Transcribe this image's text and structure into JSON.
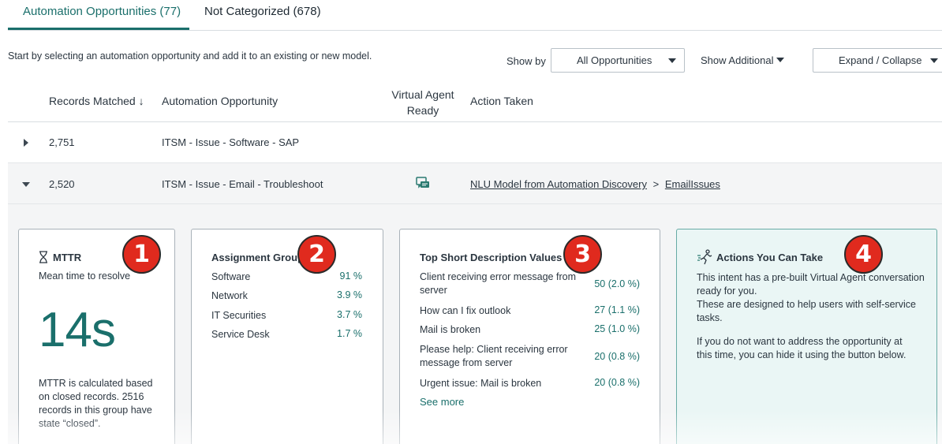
{
  "tabs": [
    {
      "label": "Automation Opportunities (77)",
      "active": true
    },
    {
      "label": "Not Categorized (678)",
      "active": false
    }
  ],
  "intro": "Start by selecting an automation opportunity and add it to an existing or new model.",
  "toolbar": {
    "show_by_label": "Show by",
    "show_by_value": "All Opportunities",
    "show_additional": "Show Additional",
    "expand_collapse": "Expand / Collapse"
  },
  "table": {
    "headers": {
      "records": "Records Matched ↓",
      "opportunity": "Automation Opportunity",
      "va_ready_line1": "Virtual Agent",
      "va_ready_line2": "Ready",
      "action": "Action Taken"
    },
    "rows": [
      {
        "records": "2,751",
        "opportunity": "ITSM - Issue - Software - SAP",
        "expanded": false
      },
      {
        "records": "2,520",
        "opportunity": "ITSM - Issue - Email - Troubleshoot",
        "expanded": true,
        "va_icon": "chat-icon",
        "action_model": "NLU Model from Automation Discovery",
        "action_sep": ">",
        "action_intent": "EmailIssues"
      }
    ]
  },
  "cards": {
    "mttr": {
      "badge": "1",
      "title": "MTTR",
      "icon": "hourglass-icon",
      "subtitle": "Mean time to resolve",
      "value": "14s",
      "note": "MTTR is calculated based on closed records. 2516 records in this group have state “closed”."
    },
    "assignment": {
      "badge": "2",
      "title": "Assignment Group",
      "items": [
        {
          "name": "Software",
          "value": "91 %"
        },
        {
          "name": "Network",
          "value": "3.9 %"
        },
        {
          "name": "IT Securities",
          "value": "3.7 %"
        },
        {
          "name": "Service Desk",
          "value": "1.7 %"
        }
      ]
    },
    "descriptions": {
      "badge": "3",
      "title": "Top Short Description Values",
      "items": [
        {
          "name": "Client receiving error message from server",
          "value": "50 (2.0 %)"
        },
        {
          "name": "How can I fix outlook",
          "value": "27 (1.1 %)"
        },
        {
          "name": "Mail is broken",
          "value": "25 (1.0 %)"
        },
        {
          "name": "Please help: Client receiving error message from server",
          "value": "20 (0.8 %)"
        },
        {
          "name": "Urgent issue: Mail is broken",
          "value": "20 (0.8 %)"
        }
      ],
      "see_more": "See more"
    },
    "actions": {
      "badge": "4",
      "title": "Actions You Can Take",
      "icon": "runner-icon",
      "p1": "This intent has a pre-built Virtual Agent conversation ready for you.",
      "p2": "These are designed to help users with self-service tasks.",
      "p3": "If you do not want to address the opportunity at this time, you can hide it using the button below."
    }
  },
  "colors": {
    "accent": "#1a6f6b",
    "badge": "#e02a1e",
    "teal_card": "#eaf6f5"
  }
}
